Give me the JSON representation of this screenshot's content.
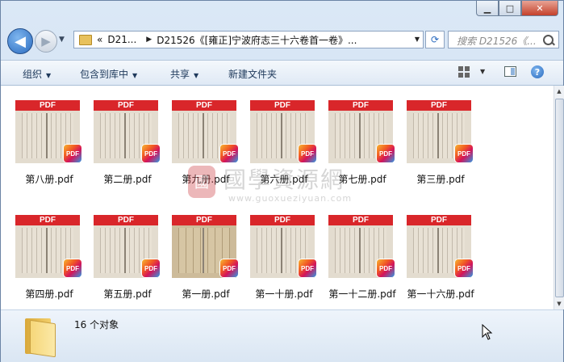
{
  "window": {
    "caption_buttons": {
      "minimize": "▁",
      "maximize": "□",
      "close": "✕"
    }
  },
  "navigation": {
    "back_icon": "◀",
    "forward_icon": "▶",
    "address_chevron": "«",
    "crumbs": [
      "D21...",
      "D21526《[雍正]宁波府志三十六卷首一卷》..."
    ],
    "search_placeholder": "搜索 D21526《...",
    "refresh_icon": "⟳"
  },
  "toolbar": {
    "organize": "组织",
    "include_in_library": "包含到库中",
    "share": "共享",
    "new_folder": "新建文件夹",
    "help_icon": "?"
  },
  "files": [
    {
      "name": "第八册.pdf",
      "thumb": "light"
    },
    {
      "name": "第二册.pdf",
      "thumb": "light"
    },
    {
      "name": "第九册.pdf",
      "thumb": "light"
    },
    {
      "name": "第六册.pdf",
      "thumb": "light"
    },
    {
      "name": "第七册.pdf",
      "thumb": "light"
    },
    {
      "name": "第三册.pdf",
      "thumb": "light"
    },
    {
      "name": "第四册.pdf",
      "thumb": "light"
    },
    {
      "name": "第五册.pdf",
      "thumb": "light"
    },
    {
      "name": "第一册.pdf",
      "thumb": "dark"
    },
    {
      "name": "第一十册.pdf",
      "thumb": "light"
    },
    {
      "name": "第一十二册.pdf",
      "thumb": "light"
    },
    {
      "name": "第一十六册.pdf",
      "thumb": "light"
    }
  ],
  "thumb_labels": {
    "banner": "PDF",
    "badge": "PDF"
  },
  "watermark": {
    "seal": "國",
    "title": "國學資源網",
    "url": "www.guoxueziyuan.com"
  },
  "status": {
    "count": "16 个对象"
  },
  "colors": {
    "pdf_red": "#d9262a",
    "toolbar_text": "#1e395b",
    "close_button": "#c4412b"
  }
}
